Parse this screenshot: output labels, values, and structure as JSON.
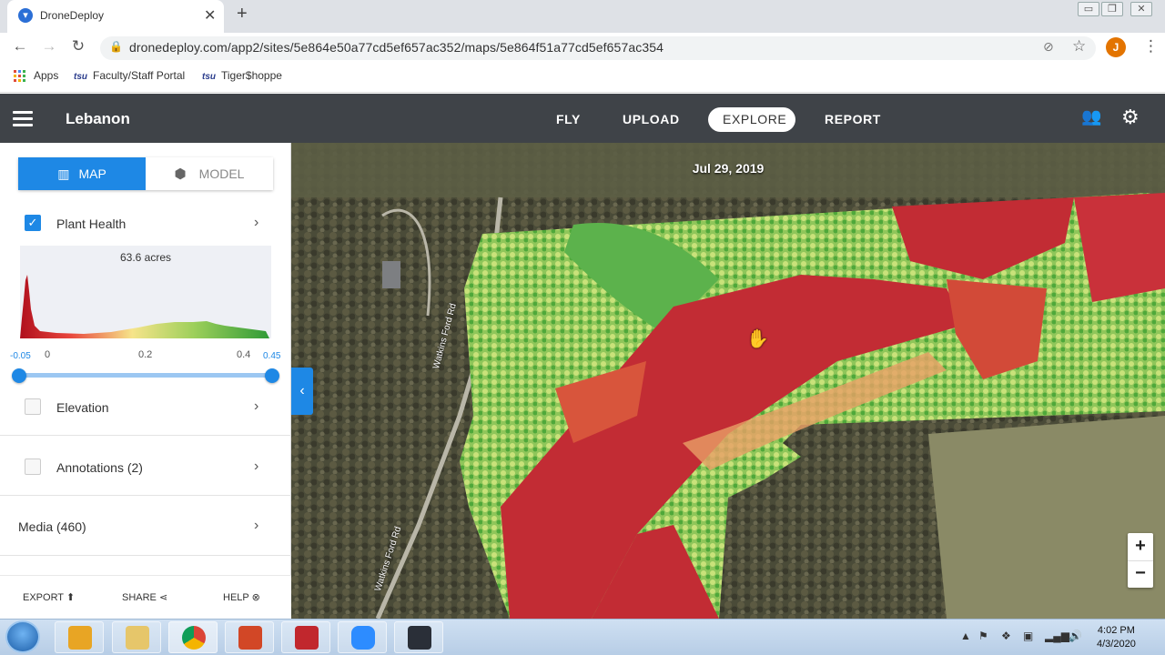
{
  "browser": {
    "tab_title": "DroneDeploy",
    "new_tab_label": "+",
    "url": "dronedeploy.com/app2/sites/5e864e50a77cd5ef657ac352/maps/5e864f51a77cd5ef657ac354",
    "profile_initial": "J",
    "bookmarks": [
      {
        "label": "Apps"
      },
      {
        "prefix": "tsu",
        "label": "Faculty/Staff Portal"
      },
      {
        "prefix": "tsu",
        "label": "Tiger$hoppe"
      }
    ]
  },
  "app": {
    "site_name": "Lebanon",
    "nav": [
      "FLY",
      "UPLOAD",
      "EXPLORE",
      "REPORT"
    ],
    "active_nav": "EXPLORE"
  },
  "panel": {
    "view_toggle": {
      "map": "MAP",
      "model": "MODEL",
      "active": "MAP"
    },
    "plant_health": {
      "label": "Plant Health",
      "checked": true,
      "area": "63.6 acres",
      "ticks": [
        "-0.05",
        "0",
        "0.2",
        "0.4",
        "0.45"
      ],
      "range_min": -0.05,
      "range_max": 0.45
    },
    "layers": [
      {
        "label": "Elevation",
        "checked": false
      },
      {
        "label": "Annotations (2)",
        "checked": false
      }
    ],
    "media": "Media (460)",
    "footer": {
      "export": "EXPORT",
      "share": "SHARE",
      "help": "HELP"
    }
  },
  "map": {
    "date": "Jul 29, 2019",
    "road_labels": [
      "Watkins Ford Rd",
      "Watkins Ford Rd"
    ],
    "zoom_in": "+",
    "zoom_out": "−",
    "collapse_glyph": "‹"
  },
  "taskbar": {
    "time": "4:02 PM",
    "date": "4/3/2020"
  },
  "colors": {
    "accent": "#1e88e5",
    "appbar": "#3f4348",
    "health_low": "#c6262f",
    "health_mid": "#f0e68c",
    "health_high": "#2e9e3a"
  }
}
